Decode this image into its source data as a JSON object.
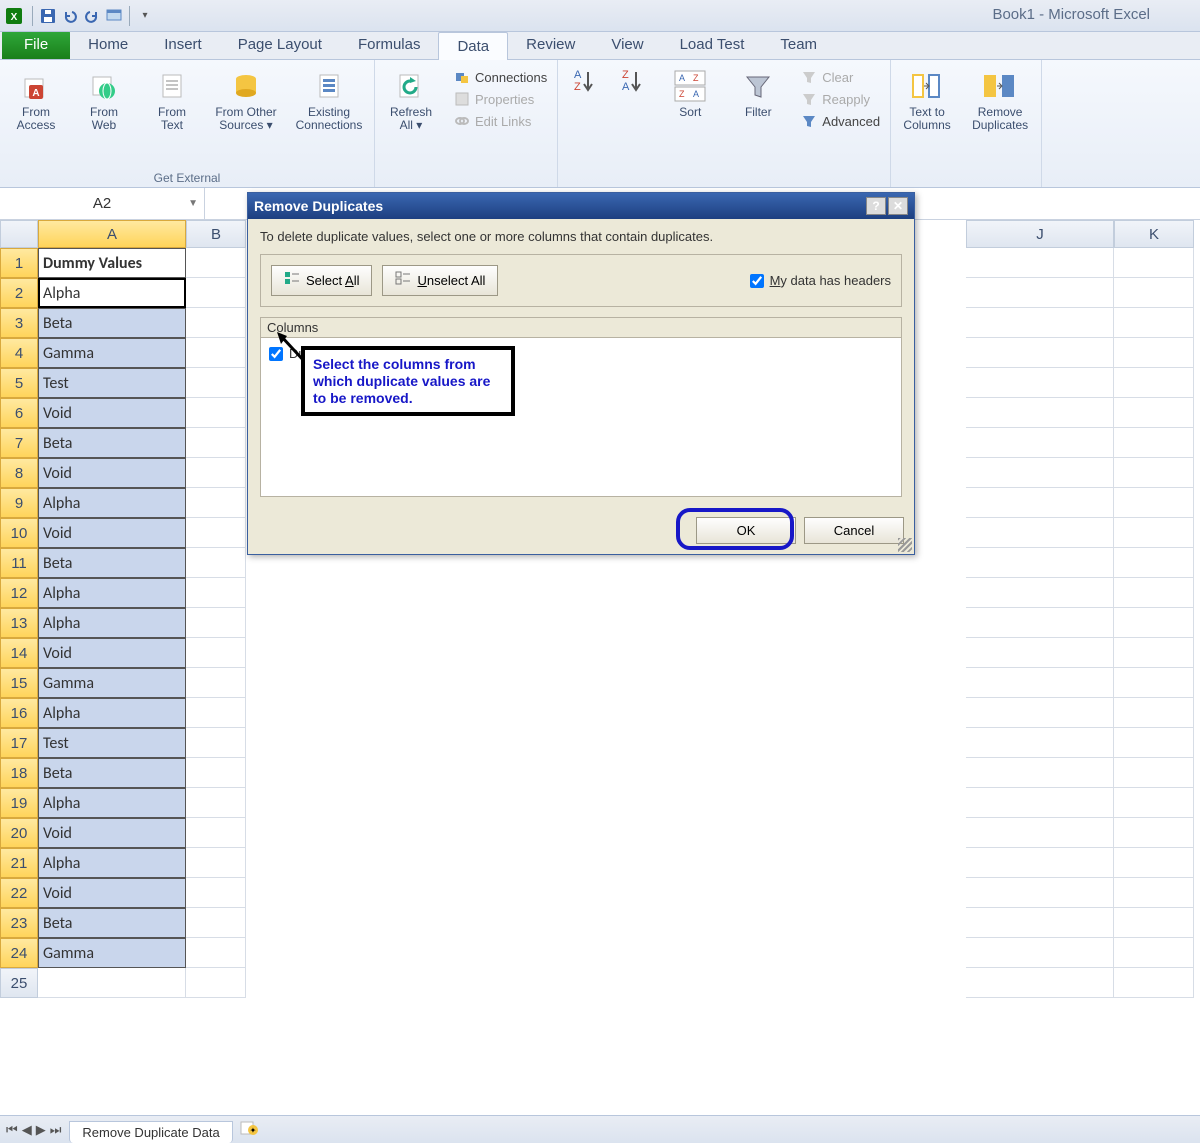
{
  "window_title": "Book1 - Microsoft Excel",
  "tabs": {
    "file": "File",
    "items": [
      "Home",
      "Insert",
      "Page Layout",
      "Formulas",
      "Data",
      "Review",
      "View",
      "Load Test",
      "Team"
    ],
    "active": "Data"
  },
  "ribbon": {
    "from_access": "From\nAccess",
    "from_web": "From\nWeb",
    "from_text": "From\nText",
    "from_other": "From Other\nSources ▾",
    "existing": "Existing\nConnections",
    "group_ext": "Get External",
    "refresh": "Refresh\nAll ▾",
    "connections": "Connections",
    "properties": "Properties",
    "edit_links": "Edit Links",
    "sort_btn": "Sort",
    "filter_btn": "Filter",
    "clear": "Clear",
    "reapply": "Reapply",
    "advanced": "Advanced",
    "text_to_cols": "Text to\nColumns",
    "remove_dups": "Remove\nDuplicates"
  },
  "name_box": "A2",
  "columns": [
    "A",
    "B",
    "J",
    "K"
  ],
  "header_cell": "Dummy Values",
  "rows": [
    "Alpha",
    "Beta",
    "Gamma",
    "Test",
    "Void",
    "Beta",
    "Void",
    "Alpha",
    "Void",
    "Beta",
    "Alpha",
    "Alpha",
    "Void",
    "Gamma",
    "Alpha",
    "Test",
    "Beta",
    "Alpha",
    "Void",
    "Alpha",
    "Void",
    "Beta",
    "Gamma"
  ],
  "sheet_tab": "Remove Duplicate Data",
  "dialog": {
    "title": "Remove Duplicates",
    "instruction": "To delete duplicate values, select one or more columns that contain duplicates.",
    "select_all": "Select All",
    "unselect_all": "Unselect All",
    "headers_label": "My data has headers",
    "columns_label": "Columns",
    "col_item": "Dummy Values",
    "callout": "Select the columns from which duplicate values are to be removed.",
    "ok": "OK",
    "cancel": "Cancel"
  }
}
